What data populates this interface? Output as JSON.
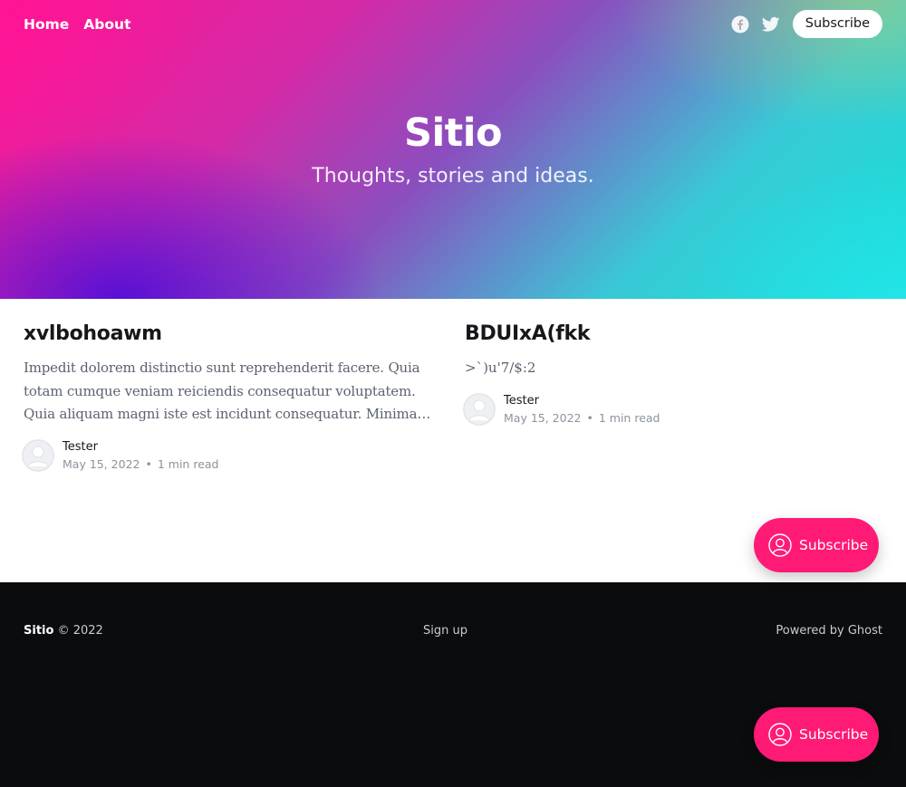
{
  "nav": {
    "items": [
      {
        "label": "Home"
      },
      {
        "label": "About"
      }
    ]
  },
  "header": {
    "social": [
      {
        "icon": "facebook-icon"
      },
      {
        "icon": "twitter-icon"
      }
    ],
    "subscribe_label": "Subscribe"
  },
  "hero": {
    "title": "Sitio",
    "description": "Thoughts, stories and ideas."
  },
  "posts": [
    {
      "title": "xvlbohoawm",
      "excerpt": "Impedit dolorem distinctio sunt reprehenderit facere. Quia totam cumque veniam reiciendis consequatur voluptatem. Quia aliquam magni iste est incidunt consequatur. Minima voluptas...",
      "author": "Tester",
      "date": "May 15, 2022",
      "separator": "•",
      "read_time": "1 min read"
    },
    {
      "title": "BDUIxA(fkk",
      "excerpt": ">`)u'7/$:2",
      "author": "Tester",
      "date": "May 15, 2022",
      "separator": "•",
      "read_time": "1 min read"
    }
  ],
  "footer": {
    "site_name": "Sitio",
    "copyright": "© 2022",
    "signup_label": "Sign up",
    "powered_label": "Powered by Ghost"
  },
  "portal": {
    "subscribe_label": "Subscribe"
  },
  "colors": {
    "accent": "#ff1a75",
    "footer_bg": "#0b0c0e"
  }
}
